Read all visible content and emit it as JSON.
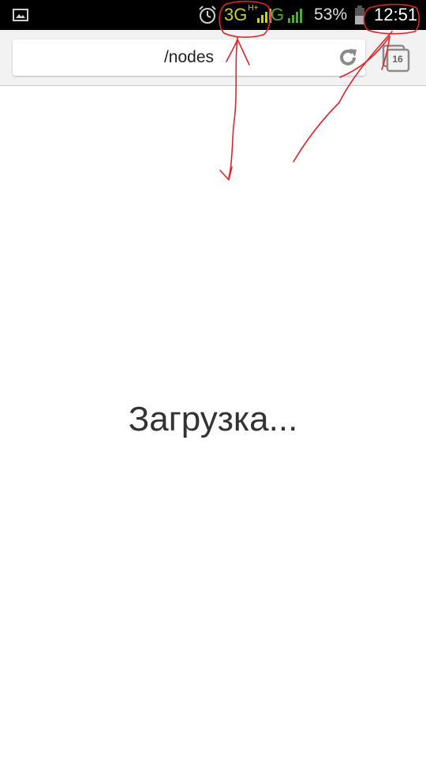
{
  "status_bar": {
    "icons": [
      "gallery-icon",
      "alarm-icon",
      "signal-icon",
      "battery-icon"
    ],
    "network_1": "3G",
    "network_1_sup": "H+",
    "network_2": "G",
    "battery_percent": "53%",
    "time": "12:51",
    "colors": {
      "network_1": "#c8d22a",
      "network_2": "#4caf28"
    }
  },
  "browser": {
    "url": "/nodes",
    "tabs_count": "16",
    "icons": [
      "reload-icon",
      "tabs-icon"
    ]
  },
  "page": {
    "loading_text": "Загрузка..."
  },
  "annotation_color": "#e0242a"
}
